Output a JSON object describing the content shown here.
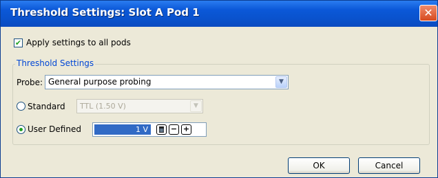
{
  "window": {
    "title": "Threshold Settings: Slot A Pod 1",
    "close_glyph": "✕"
  },
  "apply_all": {
    "label": "Apply settings to all pods",
    "checked": true
  },
  "group": {
    "title": "Threshold Settings"
  },
  "probe": {
    "label": "Probe:",
    "value": "General purpose probing"
  },
  "standard": {
    "label": "Standard",
    "value": "TTL (1.50 V)",
    "selected": false,
    "enabled": false
  },
  "user_defined": {
    "label": "User Defined",
    "value": "1 V",
    "selected": true
  },
  "buttons": {
    "ok": "OK",
    "cancel": "Cancel"
  },
  "icons": {
    "dropdown": "chevron-down-icon",
    "calculator": "calculator-icon",
    "decrement": "minus-icon",
    "increment": "plus-icon"
  },
  "colors": {
    "titlebar": "#0b58d8",
    "dialog_bg": "#ece9d8",
    "group_title": "#0046d5",
    "selection": "#316ac5",
    "check": "#21a121"
  }
}
